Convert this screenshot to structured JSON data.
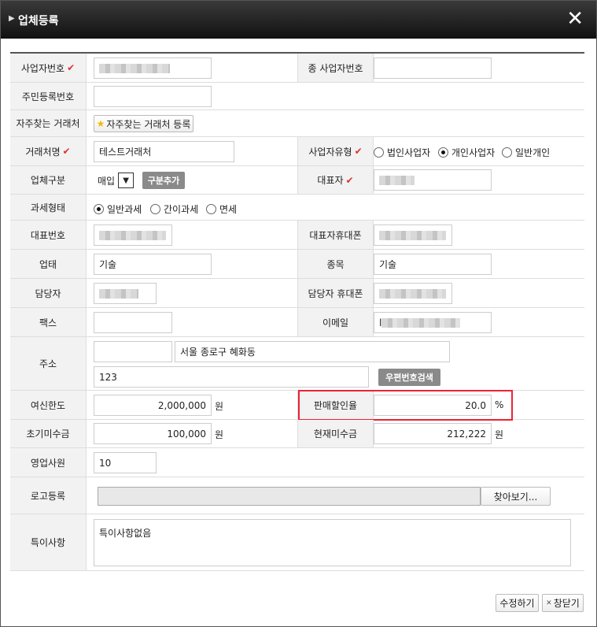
{
  "dialog": {
    "title": "업체등록",
    "close_symbol": "✕"
  },
  "form": {
    "biz_no_label": "사업자번호",
    "sub_biz_no_label": "종 사업자번호",
    "resident_no_label": "주민등록번호",
    "fav_label": "자주찾는 거래처",
    "fav_button": "자주찾는 거래처 등록",
    "client_name_label": "거래처명",
    "client_name_value": "테스트거래처",
    "biz_type_label": "사업자유형",
    "biz_type_options": [
      "법인사업자",
      "개인사업자",
      "일반개인"
    ],
    "biz_type_selected": "개인사업자",
    "category_label": "업체구분",
    "category_value": "매입",
    "category_add_button": "구분추가",
    "ceo_label": "대표자",
    "tax_label": "과세형태",
    "tax_options": [
      "일반과세",
      "간이과세",
      "면세"
    ],
    "tax_selected": "일반과세",
    "main_phone_label": "대표번호",
    "ceo_mobile_label": "대표자휴대폰",
    "business_label": "업태",
    "business_value": "기술",
    "item_label": "종목",
    "item_value": "기술",
    "manager_label": "담당자",
    "manager_mobile_label": "담당자 휴대폰",
    "fax_label": "팩스",
    "email_label": "이메일",
    "email_prefix": "l",
    "address_label": "주소",
    "address_value": "서울 종로구 혜화동",
    "address_detail": "123",
    "postcode_button": "우편번호검색",
    "credit_label": "여신한도",
    "credit_value": "2,000,000",
    "unit_won": "원",
    "discount_label": "판매할인율",
    "discount_value": "20.0",
    "unit_percent": "%",
    "initial_unpaid_label": "초기미수금",
    "initial_unpaid_value": "100,000",
    "current_unpaid_label": "현재미수금",
    "current_unpaid_value": "212,222",
    "sales_rep_label": "영업사원",
    "sales_rep_value": "10",
    "logo_label": "로고등록",
    "browse_button": "찾아보기...",
    "note_label": "특이사항",
    "note_value": "특이사항없음"
  },
  "footer": {
    "edit_button": "수정하기",
    "close_button": "창닫기",
    "close_icon_symbol": "✕"
  },
  "colors": {
    "required_check": "#dd3333",
    "highlight_border": "#ee2233",
    "titlebar": "#1a1a1a"
  }
}
